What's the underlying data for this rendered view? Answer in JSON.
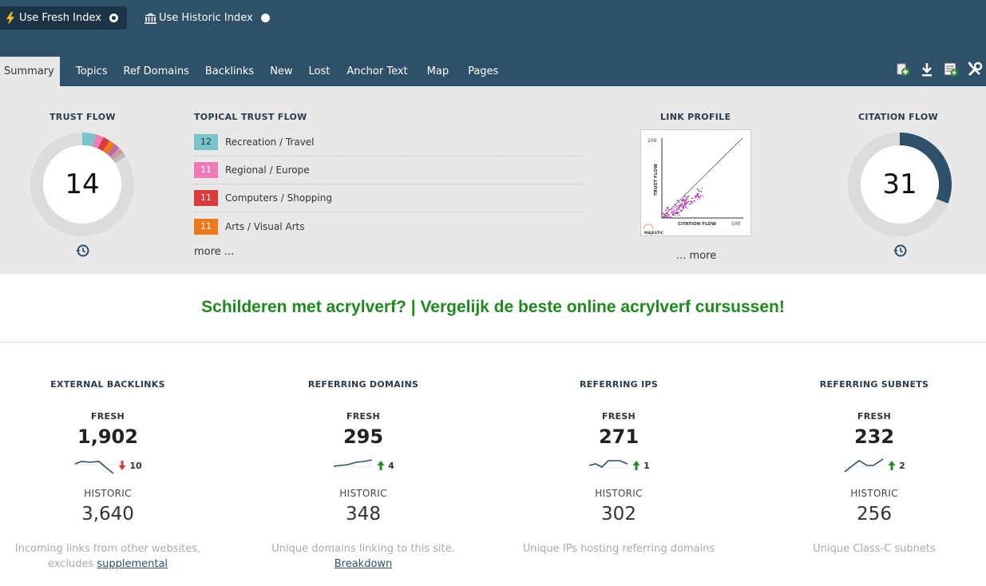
{
  "index_toggle": {
    "fresh_label": "Use Fresh Index",
    "historic_label": "Use Historic Index",
    "selected": "fresh"
  },
  "tabs": [
    {
      "label": "Summary",
      "active": true
    },
    {
      "label": "Topics"
    },
    {
      "label": "Ref Domains"
    },
    {
      "label": "Backlinks"
    },
    {
      "label": "New"
    },
    {
      "label": "Lost"
    },
    {
      "label": "Anchor Text"
    },
    {
      "label": "Map"
    },
    {
      "label": "Pages"
    }
  ],
  "toolbar_icons": [
    "add-report-icon",
    "download-icon",
    "export-icon",
    "tools-icon"
  ],
  "trust_flow": {
    "title": "TRUST FLOW",
    "value": "14"
  },
  "topical_trust_flow": {
    "title": "TOPICAL TRUST FLOW",
    "items": [
      {
        "score": "12",
        "label": "Recreation / Travel",
        "color": "#79c4c8"
      },
      {
        "score": "11",
        "label": "Regional / Europe",
        "color": "#f07ab8"
      },
      {
        "score": "11",
        "label": "Computers / Shopping",
        "color": "#d93a3a"
      },
      {
        "score": "11",
        "label": "Arts / Visual Arts",
        "color": "#f07a1a"
      }
    ],
    "more": "more ..."
  },
  "link_profile": {
    "title": "LINK PROFILE",
    "y_label": "TRUST FLOW",
    "x_label": "CITATION FLOW",
    "y_max": "100",
    "x_max": "100",
    "brand": "MAJESTIC",
    "more": "... more"
  },
  "citation_flow": {
    "title": "CITATION FLOW",
    "value": "31",
    "fraction": 0.31
  },
  "site_title": "Schilderen met acrylverf? | Vergelijk de beste online acrylverf cursussen!",
  "stats": [
    {
      "head": "EXTERNAL BACKLINKS",
      "fresh_label": "FRESH",
      "fresh": "1,902",
      "trend": "down",
      "delta": "10",
      "historic_label": "HISTORIC",
      "historic": "3,640",
      "desc": "Incoming links from other websites, excludes",
      "link": "supplemental"
    },
    {
      "head": "REFERRING DOMAINS",
      "fresh_label": "FRESH",
      "fresh": "295",
      "trend": "up",
      "delta": "4",
      "historic_label": "HISTORIC",
      "historic": "348",
      "desc": "Unique domains linking to this site.",
      "link": "Breakdown"
    },
    {
      "head": "REFERRING IPS",
      "fresh_label": "FRESH",
      "fresh": "271",
      "trend": "up",
      "delta": "1",
      "historic_label": "HISTORIC",
      "historic": "302",
      "desc": "Unique IPs hosting referring domains",
      "link": ""
    },
    {
      "head": "REFERRING SUBNETS",
      "fresh_label": "FRESH",
      "fresh": "232",
      "trend": "up",
      "delta": "2",
      "historic_label": "HISTORIC",
      "historic": "256",
      "desc": "Unique Class-C subnets",
      "link": ""
    }
  ],
  "colors": {
    "header_bg": "#2e5069",
    "summary_bg": "#e8e8e8",
    "title_green": "#1e8a1e",
    "up_arrow": "#2a8a2a",
    "down_arrow": "#d93a3a"
  }
}
